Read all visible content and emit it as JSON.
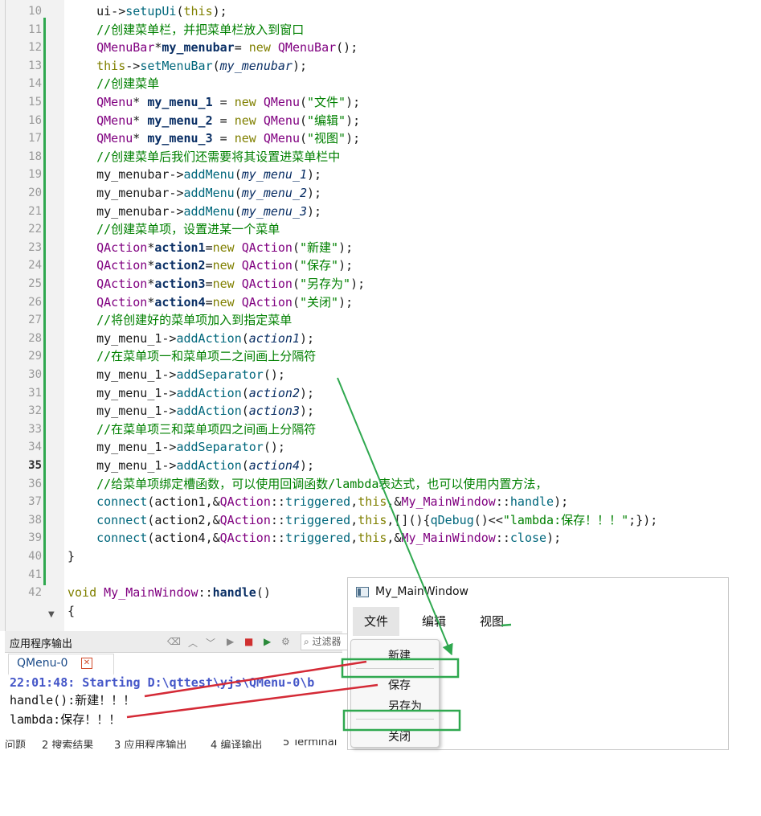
{
  "editor": {
    "lines": [
      {
        "num": "10",
        "tokens": [
          {
            "t": "    ui->"
          },
          {
            "t": "setupUi",
            "c": "t-fn"
          },
          {
            "t": "("
          },
          {
            "t": "this",
            "c": "t-kw"
          },
          {
            "t": ");"
          }
        ]
      },
      {
        "num": "11",
        "tokens": [
          {
            "t": "    "
          },
          {
            "t": "//创建菜单栏，并把菜单栏放入到窗口",
            "c": "t-cm"
          }
        ]
      },
      {
        "num": "12",
        "tokens": [
          {
            "t": "    "
          },
          {
            "t": "QMenuBar",
            "c": "t-cls"
          },
          {
            "t": "*"
          },
          {
            "t": "my_menubar",
            "c": "t-b"
          },
          {
            "t": "= "
          },
          {
            "t": "new",
            "c": "t-kw"
          },
          {
            "t": " "
          },
          {
            "t": "QMenuBar",
            "c": "t-cls"
          },
          {
            "t": "();"
          }
        ]
      },
      {
        "num": "13",
        "tokens": [
          {
            "t": "    "
          },
          {
            "t": "this",
            "c": "t-kw"
          },
          {
            "t": "->"
          },
          {
            "t": "setMenuBar",
            "c": "t-fn"
          },
          {
            "t": "("
          },
          {
            "t": "my_menubar",
            "c": "t-i"
          },
          {
            "t": ");"
          }
        ]
      },
      {
        "num": "14",
        "tokens": [
          {
            "t": "    "
          },
          {
            "t": "//创建菜单",
            "c": "t-cm"
          }
        ]
      },
      {
        "num": "15",
        "tokens": [
          {
            "t": "    "
          },
          {
            "t": "QMenu",
            "c": "t-cls"
          },
          {
            "t": "* "
          },
          {
            "t": "my_menu_1",
            "c": "t-b"
          },
          {
            "t": " = "
          },
          {
            "t": "new",
            "c": "t-kw"
          },
          {
            "t": " "
          },
          {
            "t": "QMenu",
            "c": "t-cls"
          },
          {
            "t": "("
          },
          {
            "t": "\"文件\"",
            "c": "t-str"
          },
          {
            "t": ");"
          }
        ]
      },
      {
        "num": "16",
        "tokens": [
          {
            "t": "    "
          },
          {
            "t": "QMenu",
            "c": "t-cls"
          },
          {
            "t": "* "
          },
          {
            "t": "my_menu_2",
            "c": "t-b"
          },
          {
            "t": " = "
          },
          {
            "t": "new",
            "c": "t-kw"
          },
          {
            "t": " "
          },
          {
            "t": "QMenu",
            "c": "t-cls"
          },
          {
            "t": "("
          },
          {
            "t": "\"编辑\"",
            "c": "t-str"
          },
          {
            "t": ");"
          }
        ]
      },
      {
        "num": "17",
        "tokens": [
          {
            "t": "    "
          },
          {
            "t": "QMenu",
            "c": "t-cls"
          },
          {
            "t": "* "
          },
          {
            "t": "my_menu_3",
            "c": "t-b"
          },
          {
            "t": " = "
          },
          {
            "t": "new",
            "c": "t-kw"
          },
          {
            "t": " "
          },
          {
            "t": "QMenu",
            "c": "t-cls"
          },
          {
            "t": "("
          },
          {
            "t": "\"视图\"",
            "c": "t-str"
          },
          {
            "t": ");"
          }
        ]
      },
      {
        "num": "18",
        "tokens": [
          {
            "t": "    "
          },
          {
            "t": "//创建菜单后我们还需要将其设置进菜单栏中",
            "c": "t-cm"
          }
        ]
      },
      {
        "num": "19",
        "tokens": [
          {
            "t": "    my_menubar->"
          },
          {
            "t": "addMenu",
            "c": "t-fn"
          },
          {
            "t": "("
          },
          {
            "t": "my_menu_1",
            "c": "t-i"
          },
          {
            "t": ");"
          }
        ]
      },
      {
        "num": "20",
        "tokens": [
          {
            "t": "    my_menubar->"
          },
          {
            "t": "addMenu",
            "c": "t-fn"
          },
          {
            "t": "("
          },
          {
            "t": "my_menu_2",
            "c": "t-i"
          },
          {
            "t": ");"
          }
        ]
      },
      {
        "num": "21",
        "tokens": [
          {
            "t": "    my_menubar->"
          },
          {
            "t": "addMenu",
            "c": "t-fn"
          },
          {
            "t": "("
          },
          {
            "t": "my_menu_3",
            "c": "t-i"
          },
          {
            "t": ");"
          }
        ]
      },
      {
        "num": "22",
        "tokens": [
          {
            "t": "    "
          },
          {
            "t": "//创建菜单项，设置进某一个菜单",
            "c": "t-cm"
          }
        ]
      },
      {
        "num": "23",
        "tokens": [
          {
            "t": "    "
          },
          {
            "t": "QAction",
            "c": "t-cls"
          },
          {
            "t": "*"
          },
          {
            "t": "action1",
            "c": "t-b"
          },
          {
            "t": "="
          },
          {
            "t": "new",
            "c": "t-kw"
          },
          {
            "t": " "
          },
          {
            "t": "QAction",
            "c": "t-cls"
          },
          {
            "t": "("
          },
          {
            "t": "\"新建\"",
            "c": "t-str"
          },
          {
            "t": ");"
          }
        ]
      },
      {
        "num": "24",
        "tokens": [
          {
            "t": "    "
          },
          {
            "t": "QAction",
            "c": "t-cls"
          },
          {
            "t": "*"
          },
          {
            "t": "action2",
            "c": "t-b"
          },
          {
            "t": "="
          },
          {
            "t": "new",
            "c": "t-kw"
          },
          {
            "t": " "
          },
          {
            "t": "QAction",
            "c": "t-cls"
          },
          {
            "t": "("
          },
          {
            "t": "\"保存\"",
            "c": "t-str"
          },
          {
            "t": ");"
          }
        ]
      },
      {
        "num": "25",
        "tokens": [
          {
            "t": "    "
          },
          {
            "t": "QAction",
            "c": "t-cls"
          },
          {
            "t": "*"
          },
          {
            "t": "action3",
            "c": "t-b"
          },
          {
            "t": "="
          },
          {
            "t": "new",
            "c": "t-kw"
          },
          {
            "t": " "
          },
          {
            "t": "QAction",
            "c": "t-cls"
          },
          {
            "t": "("
          },
          {
            "t": "\"另存为\"",
            "c": "t-str"
          },
          {
            "t": ");"
          }
        ]
      },
      {
        "num": "26",
        "tokens": [
          {
            "t": "    "
          },
          {
            "t": "QAction",
            "c": "t-cls"
          },
          {
            "t": "*"
          },
          {
            "t": "action4",
            "c": "t-b"
          },
          {
            "t": "="
          },
          {
            "t": "new",
            "c": "t-kw"
          },
          {
            "t": " "
          },
          {
            "t": "QAction",
            "c": "t-cls"
          },
          {
            "t": "("
          },
          {
            "t": "\"关闭\"",
            "c": "t-str"
          },
          {
            "t": ");"
          }
        ]
      },
      {
        "num": "27",
        "tokens": [
          {
            "t": "    "
          },
          {
            "t": "//将创建好的菜单项加入到指定菜单",
            "c": "t-cm"
          }
        ]
      },
      {
        "num": "28",
        "tokens": [
          {
            "t": "    my_menu_1->"
          },
          {
            "t": "addAction",
            "c": "t-fn"
          },
          {
            "t": "("
          },
          {
            "t": "action1",
            "c": "t-i"
          },
          {
            "t": ");"
          }
        ]
      },
      {
        "num": "29",
        "tokens": [
          {
            "t": "    "
          },
          {
            "t": "//在菜单项一和菜单项二之间画上分隔符",
            "c": "t-cm"
          }
        ]
      },
      {
        "num": "30",
        "tokens": [
          {
            "t": "    my_menu_1->"
          },
          {
            "t": "addSeparator",
            "c": "t-fn"
          },
          {
            "t": "();"
          }
        ]
      },
      {
        "num": "31",
        "tokens": [
          {
            "t": "    my_menu_1->"
          },
          {
            "t": "addAction",
            "c": "t-fn"
          },
          {
            "t": "("
          },
          {
            "t": "action2",
            "c": "t-i"
          },
          {
            "t": ");"
          }
        ]
      },
      {
        "num": "32",
        "tokens": [
          {
            "t": "    my_menu_1->"
          },
          {
            "t": "addAction",
            "c": "t-fn"
          },
          {
            "t": "("
          },
          {
            "t": "action3",
            "c": "t-i"
          },
          {
            "t": ");"
          }
        ]
      },
      {
        "num": "33",
        "tokens": [
          {
            "t": "    "
          },
          {
            "t": "//在菜单项三和菜单项四之间画上分隔符",
            "c": "t-cm"
          }
        ]
      },
      {
        "num": "34",
        "tokens": [
          {
            "t": "    my_menu_1->"
          },
          {
            "t": "addSeparator",
            "c": "t-fn"
          },
          {
            "t": "();"
          }
        ]
      },
      {
        "num": "35",
        "tokens": [
          {
            "t": "    my_menu_1->"
          },
          {
            "t": "addAction",
            "c": "t-fn"
          },
          {
            "t": "("
          },
          {
            "t": "action4",
            "c": "t-i"
          },
          {
            "t": ");"
          }
        ]
      },
      {
        "num": "36",
        "tokens": [
          {
            "t": "    "
          },
          {
            "t": "//给菜单项绑定槽函数，可以使用回调函数/lambda表达式，也可以使用内置方法，",
            "c": "t-cm"
          }
        ]
      },
      {
        "num": "37",
        "tokens": [
          {
            "t": "    "
          },
          {
            "t": "connect",
            "c": "t-fn"
          },
          {
            "t": "(action1,&"
          },
          {
            "t": "QAction",
            "c": "t-cls"
          },
          {
            "t": "::"
          },
          {
            "t": "triggered",
            "c": "t-fn"
          },
          {
            "t": ","
          },
          {
            "t": "this",
            "c": "t-kw"
          },
          {
            "t": ",&"
          },
          {
            "t": "My_MainWindow",
            "c": "t-cls"
          },
          {
            "t": "::"
          },
          {
            "t": "handle",
            "c": "t-fn"
          },
          {
            "t": ");"
          }
        ]
      },
      {
        "num": "38",
        "tokens": [
          {
            "t": "    "
          },
          {
            "t": "connect",
            "c": "t-fn"
          },
          {
            "t": "(action2,&"
          },
          {
            "t": "QAction",
            "c": "t-cls"
          },
          {
            "t": "::"
          },
          {
            "t": "triggered",
            "c": "t-fn"
          },
          {
            "t": ","
          },
          {
            "t": "this",
            "c": "t-kw"
          },
          {
            "t": ",[](){"
          },
          {
            "t": "qDebug",
            "c": "t-fn"
          },
          {
            "t": "()<<"
          },
          {
            "t": "\"lambda:保存！！！\"",
            "c": "t-str"
          },
          {
            "t": ";});"
          }
        ]
      },
      {
        "num": "39",
        "tokens": [
          {
            "t": "    "
          },
          {
            "t": "connect",
            "c": "t-fn"
          },
          {
            "t": "(action4,&"
          },
          {
            "t": "QAction",
            "c": "t-cls"
          },
          {
            "t": "::"
          },
          {
            "t": "triggered",
            "c": "t-fn"
          },
          {
            "t": ","
          },
          {
            "t": "this",
            "c": "t-kw"
          },
          {
            "t": ",&"
          },
          {
            "t": "My_MainWindow",
            "c": "t-cls"
          },
          {
            "t": "::"
          },
          {
            "t": "close",
            "c": "t-fn"
          },
          {
            "t": ");"
          }
        ]
      },
      {
        "num": "40",
        "tokens": [
          {
            "t": "}"
          }
        ]
      },
      {
        "num": "41",
        "tokens": []
      },
      {
        "num": "42",
        "tokens": [
          {
            "t": "void",
            "c": "t-kw"
          },
          {
            "t": " "
          },
          {
            "t": "My_MainWindow",
            "c": "t-cls"
          },
          {
            "t": "::"
          },
          {
            "t": "handle",
            "c": "t-b"
          },
          {
            "t": "()"
          }
        ]
      },
      {
        "num": "",
        "tokens": [
          {
            "t": "{"
          }
        ]
      }
    ],
    "current_line": "35"
  },
  "output": {
    "title": "应用程序输出",
    "filter_placeholder": "过滤器",
    "tab_label": "QMenu-0",
    "lines": [
      {
        "text": "22:01:48: Starting D:\\qttest\\yjs\\QMenu-0\\b",
        "kind": "start"
      },
      {
        "text": "handle():新建！！！",
        "kind": "normal"
      },
      {
        "text": "lambda:保存！！！",
        "kind": "normal"
      }
    ],
    "bottom_tabs": [
      "问题",
      "2 搜索结果",
      "3 应用程序输出",
      "4 编译输出",
      "5 Terminal"
    ]
  },
  "window": {
    "title": "My_MainWindow",
    "menus": [
      "文件",
      "编辑",
      "视图"
    ],
    "popup_items": [
      "新建",
      "保存",
      "另存为",
      "关闭"
    ]
  },
  "colors": {
    "annotation_green": "#2fa84f",
    "annotation_red": "#d42a36"
  }
}
